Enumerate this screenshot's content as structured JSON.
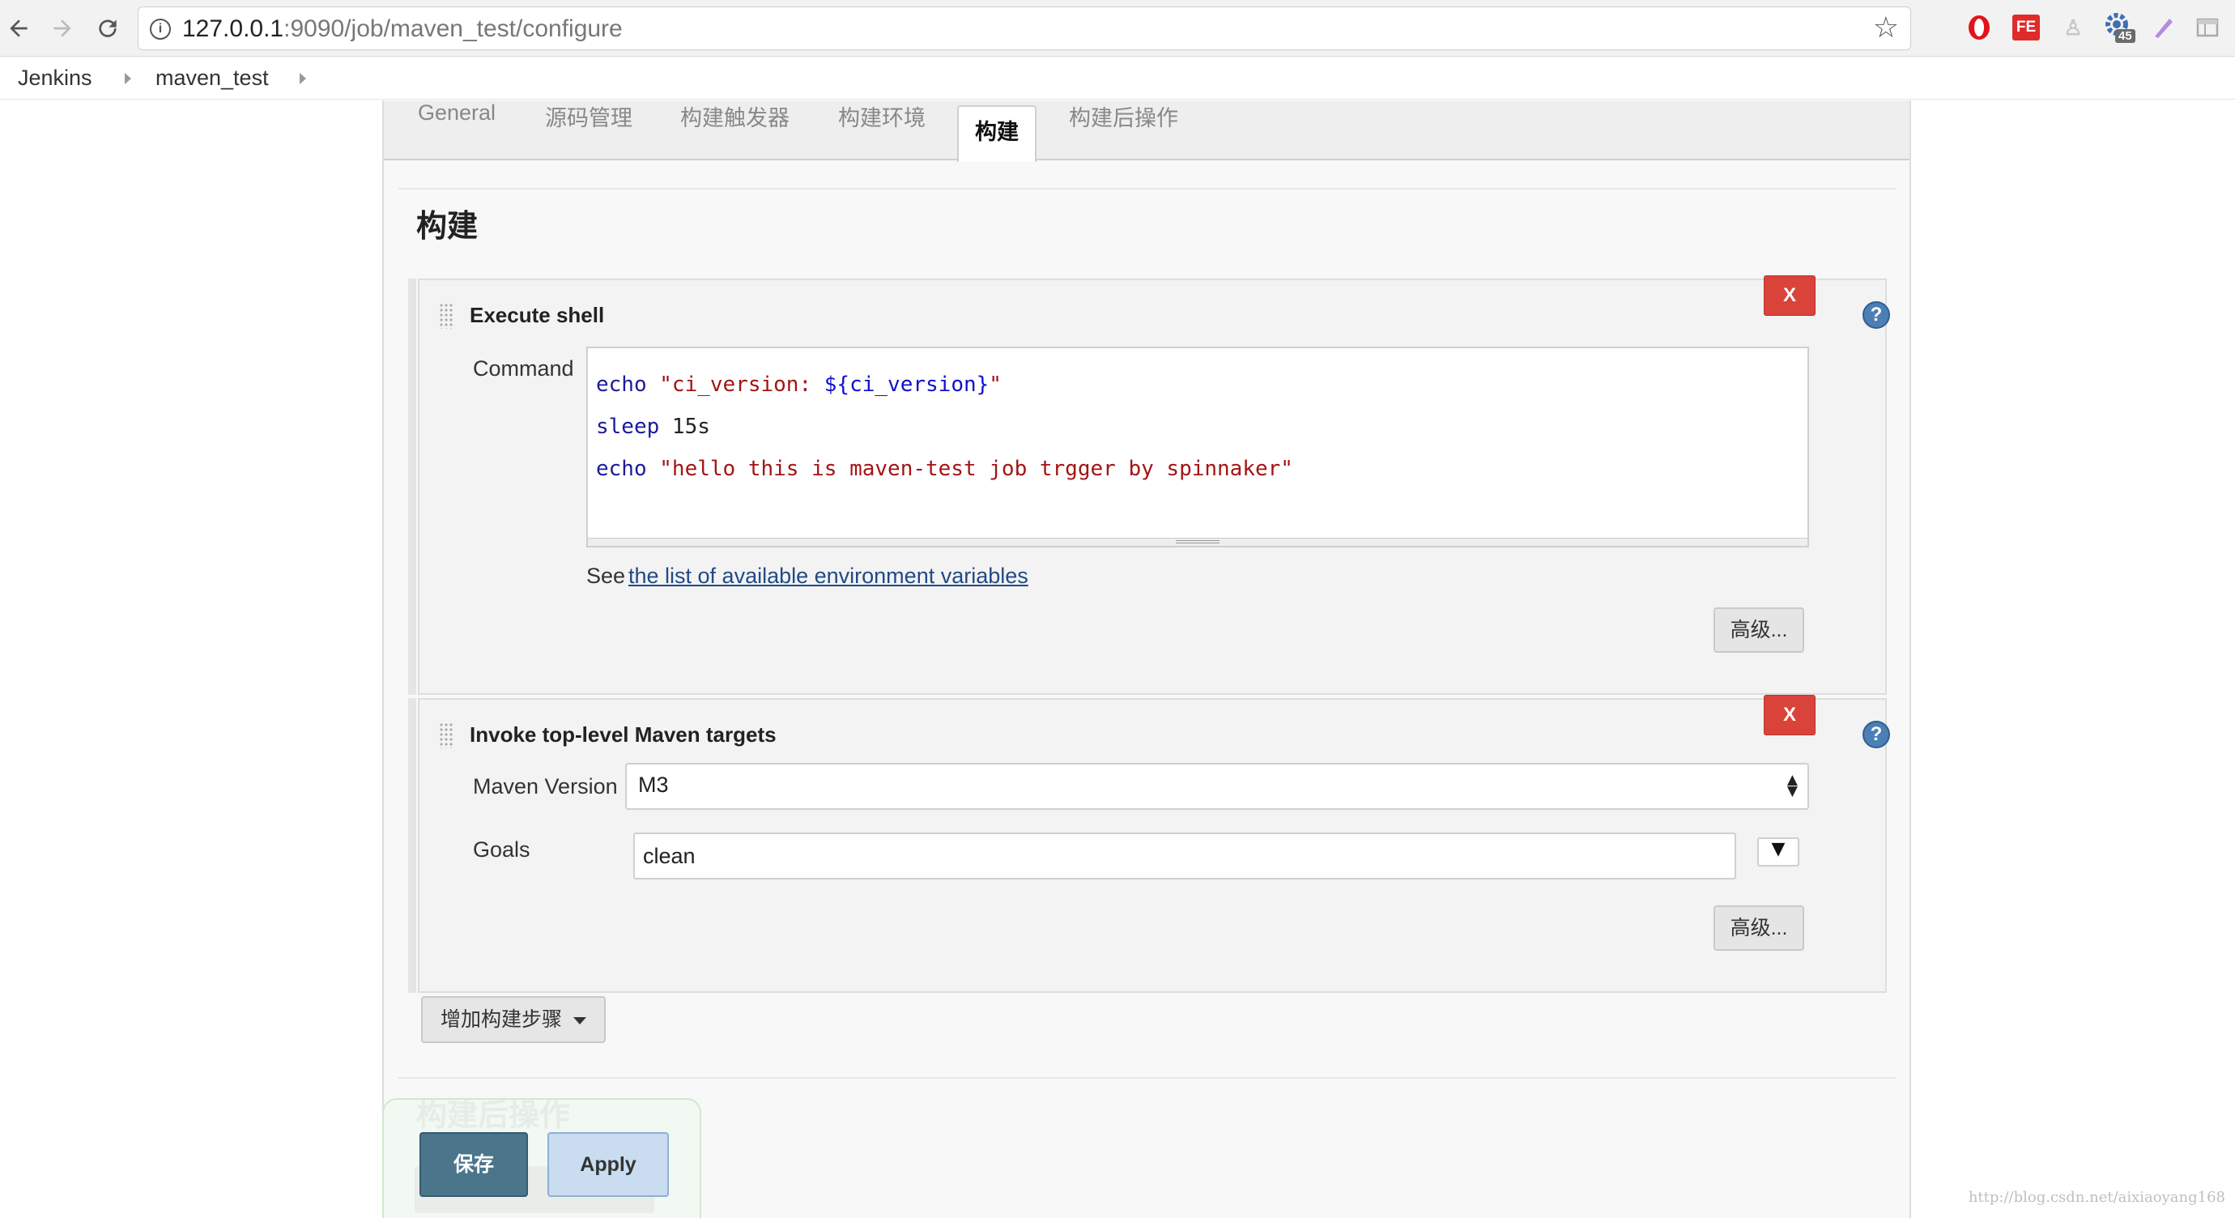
{
  "browser": {
    "url_host": "127.0.0.1",
    "url_rest": ":9090/job/maven_test/configure",
    "extensions_badge": "45",
    "icons": [
      "back-icon",
      "forward-icon",
      "reload-icon",
      "info-icon",
      "star-icon",
      "opera-icon",
      "fe-icon",
      "extension-icon",
      "gear-badge-icon",
      "pen-icon",
      "panel-icon"
    ]
  },
  "breadcrumb": {
    "items": [
      "Jenkins",
      "maven_test"
    ]
  },
  "tabs": [
    "General",
    "源码管理",
    "构建触发器",
    "构建环境",
    "构建",
    "构建后操作"
  ],
  "active_tab": "构建",
  "build": {
    "section_title": "构建",
    "execute_shell": {
      "title": "Execute shell",
      "delete_label": "X",
      "help_label": "?",
      "command_label": "Command",
      "command_lines": [
        {
          "kw": "echo",
          "str": " \"ci_version: ",
          "var": "${ci_version}",
          "str2": "\""
        },
        {
          "kw": "sleep",
          "plain": " 15s"
        },
        {
          "kw": "echo",
          "str": " \"hello this is maven-test job trgger by spinnaker\""
        }
      ],
      "see_text": "See",
      "env_link": "the list of available environment variables",
      "advanced_label": "高级..."
    },
    "maven_targets": {
      "title": "Invoke top-level Maven targets",
      "delete_label": "X",
      "help_label": "?",
      "version_label": "Maven Version",
      "version_value": "M3",
      "goals_label": "Goals",
      "goals_value": "clean",
      "advanced_label": "高级..."
    },
    "add_step_label": "增加构建步骤"
  },
  "post_build": {
    "section_title": "构建后操作"
  },
  "actions": {
    "save_label": "保存",
    "apply_label": "Apply"
  },
  "watermark": "http://blog.csdn.net/aixiaoyang168",
  "colors": {
    "delete_red": "#d9433a",
    "save_blue": "#4b758b",
    "apply_light": "#c9dcf0",
    "link": "#204a87",
    "help_blue": "#4b7fb5"
  }
}
